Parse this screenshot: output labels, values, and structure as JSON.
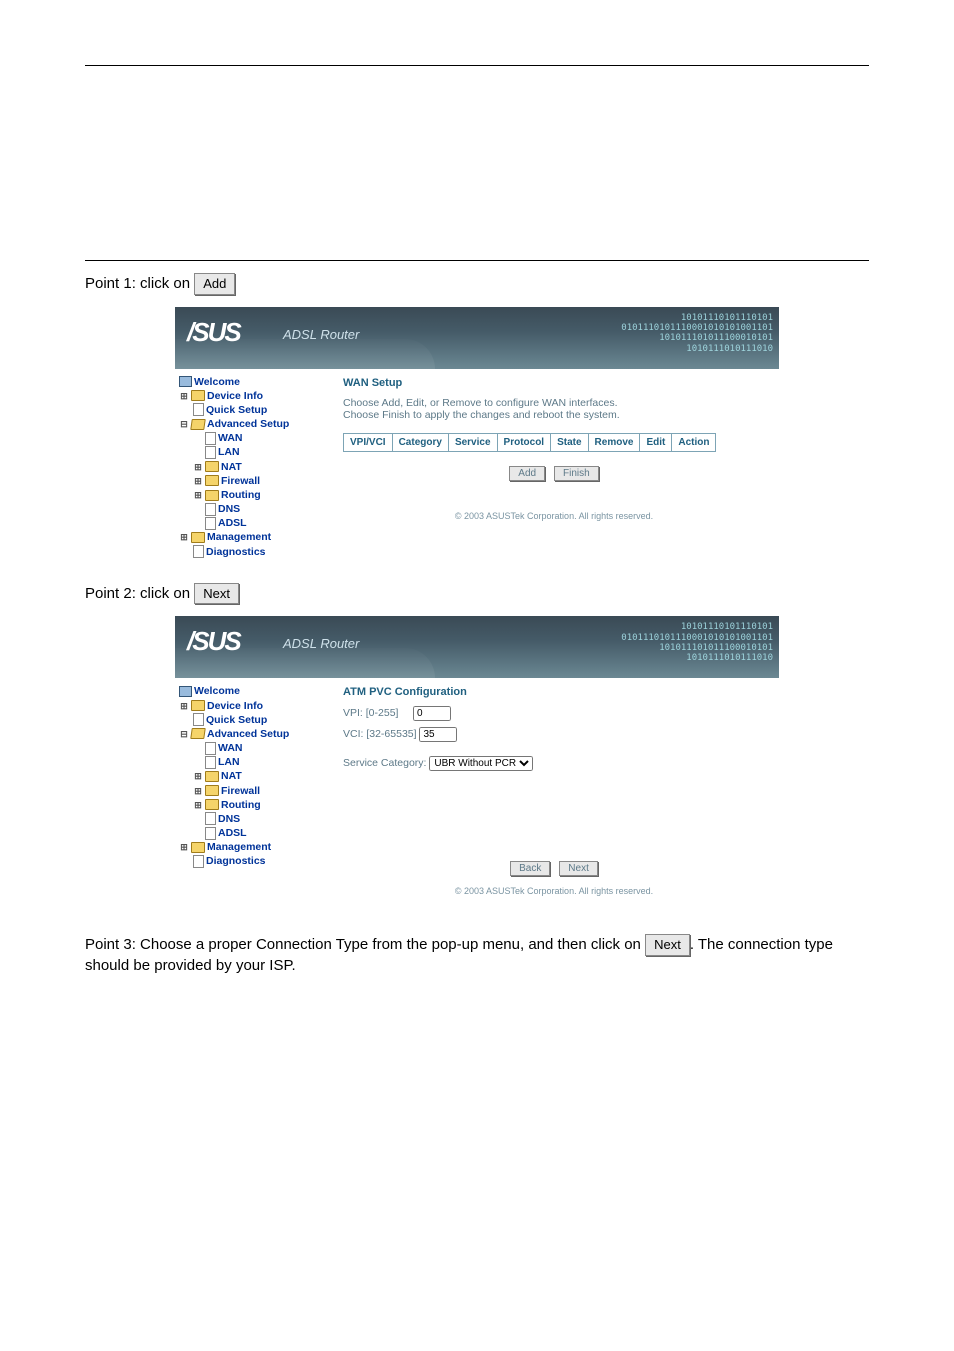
{
  "doc": {
    "point1_prefix": "Point 1: click on",
    "point2_prefix": "Point 2: click on",
    "add_label": "Add",
    "next_label": "Next",
    "point3": "Point 3: Choose a proper Connection Type from the pop-up menu, and then click on",
    "point3_rest": ". The connection type should be provided by your ISP.",
    "next_label2": "Next"
  },
  "brand": {
    "logo": "/SUS",
    "sub": "ADSL Router",
    "digits": "10101110101110101\n0101110101110001010101001101\n101011101011100010101\n1010111010111010"
  },
  "nav": {
    "welcome": "Welcome",
    "device_info": "Device Info",
    "quick_setup": "Quick Setup",
    "advanced_setup": "Advanced Setup",
    "wan": "WAN",
    "lan": "LAN",
    "nat": "NAT",
    "firewall": "Firewall",
    "routing": "Routing",
    "dns": "DNS",
    "adsl": "ADSL",
    "management": "Management",
    "diagnostics": "Diagnostics"
  },
  "wan_setup": {
    "title": "WAN Setup",
    "line1": "Choose Add, Edit, or Remove to configure WAN interfaces.",
    "line2": "Choose Finish to apply the changes and reboot the system.",
    "cols": {
      "vpivci": "VPI/VCI",
      "category": "Category",
      "service": "Service",
      "protocol": "Protocol",
      "state": "State",
      "remove": "Remove",
      "edit": "Edit",
      "action": "Action"
    },
    "add_btn": "Add",
    "finish_btn": "Finish",
    "copyright": "© 2003 ASUSTek Corporation. All rights reserved."
  },
  "atm": {
    "title": "ATM PVC Configuration",
    "vpi_label": "VPI: [0-255]",
    "vpi_value": "0",
    "vci_label": "VCI: [32-65535]",
    "vci_value": "35",
    "service_label": "Service Category:",
    "service_value": "UBR Without PCR",
    "back_btn": "Back",
    "next_btn": "Next",
    "copyright": "© 2003 ASUSTek Corporation. All rights reserved."
  }
}
